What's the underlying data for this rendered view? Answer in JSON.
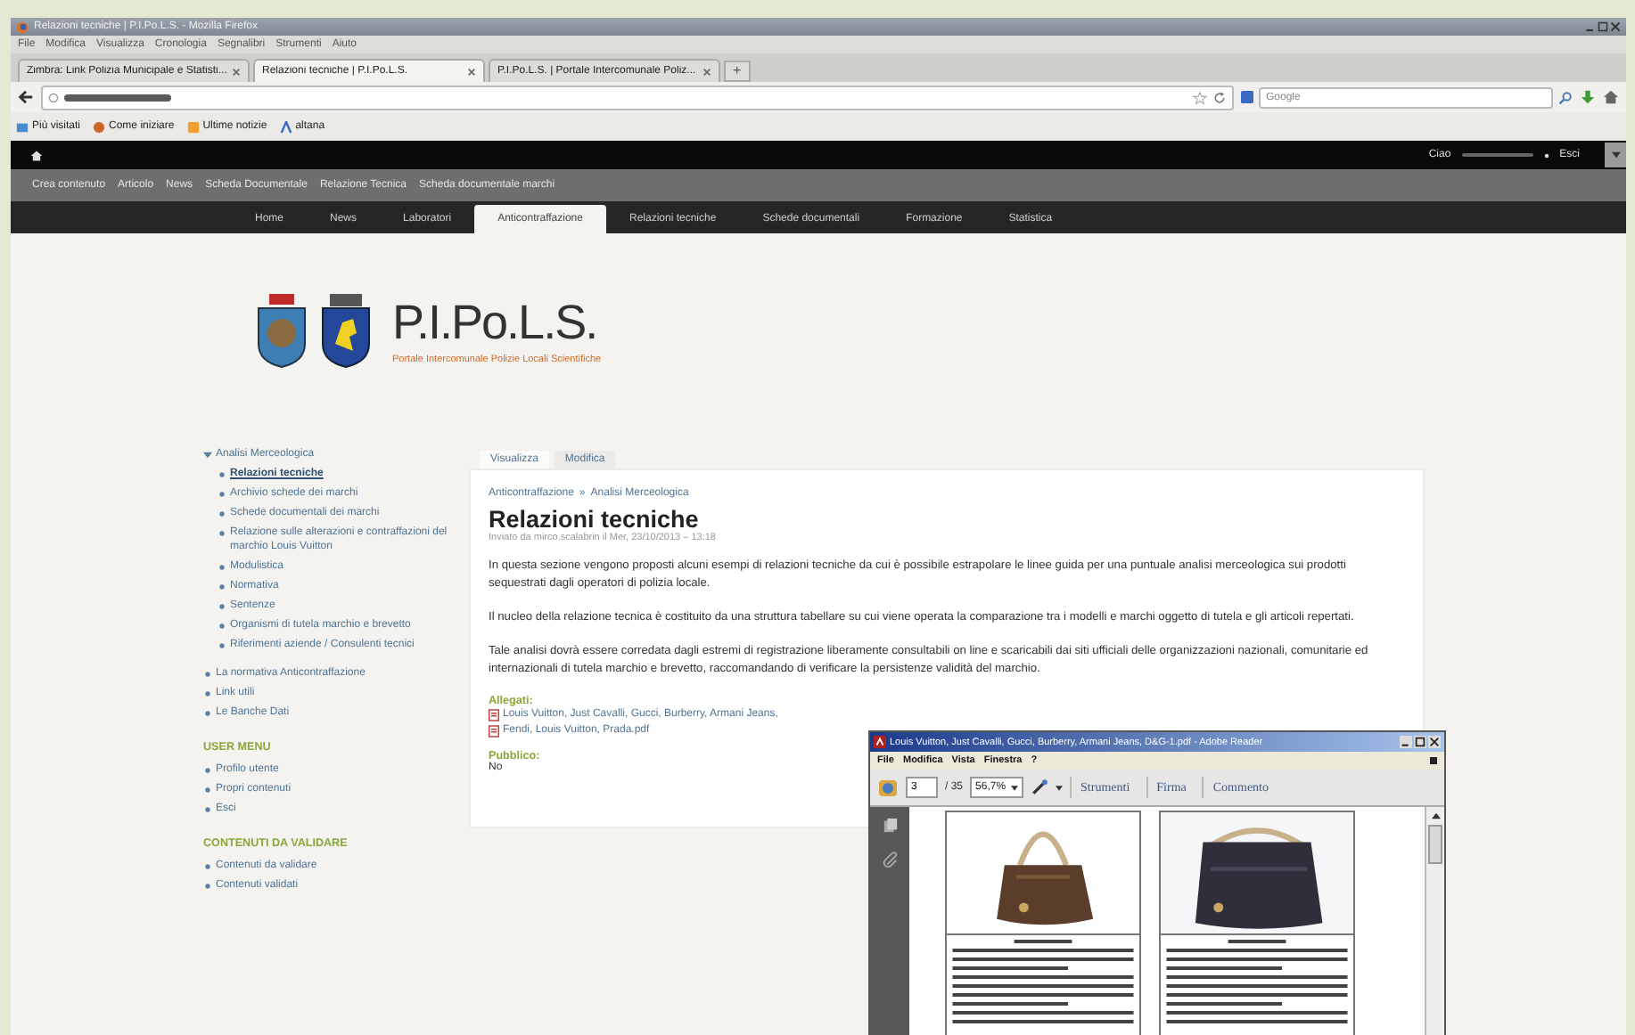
{
  "browser": {
    "title": "Relazioni tecniche | P.I.Po.L.S. - Mozilla Firefox",
    "menu": [
      "File",
      "Modifica",
      "Visualizza",
      "Cronologia",
      "Segnalibri",
      "Strumenti",
      "Aiuto"
    ],
    "tabs": [
      {
        "label": "Zimbra: Link Polizia Municipale e Statisti...",
        "selected": false
      },
      {
        "label": "Relazioni tecniche | P.I.Po.L.S.",
        "selected": true
      },
      {
        "label": "P.I.Po.L.S. | Portale Intercomunale Poliz...",
        "selected": false
      }
    ],
    "new_tab": "+",
    "search": {
      "placeholder": "Google"
    },
    "bookmarks": [
      "Più visitati",
      "Come iniziare",
      "Ultime notizie",
      "altana"
    ]
  },
  "toolbar": {
    "greeting": "Ciao",
    "logout": "Esci"
  },
  "shortcuts": [
    "Crea contenuto",
    "Articolo",
    "News",
    "Scheda Documentale",
    "Relazione Tecnica",
    "Scheda documentale marchi"
  ],
  "nav": [
    {
      "label": "Home",
      "selected": false
    },
    {
      "label": "News",
      "selected": false
    },
    {
      "label": "Laboratori",
      "selected": false
    },
    {
      "label": "Anticontraffazione",
      "selected": true
    },
    {
      "label": "Relazioni tecniche",
      "selected": false
    },
    {
      "label": "Schede documentali",
      "selected": false
    },
    {
      "label": "Formazione",
      "selected": false
    },
    {
      "label": "Statistica",
      "selected": false
    }
  ],
  "site": {
    "name": "P.I.Po.L.S.",
    "slogan": "Portale Intercomunale Polizie Locali Scientifiche"
  },
  "sidebar": {
    "tree": [
      {
        "label": "Analisi Merceologica",
        "selected": false,
        "expanded": true,
        "children": [
          {
            "label": "Relazioni tecniche",
            "selected": true
          },
          {
            "label": "Archivio schede dei marchi",
            "selected": false
          },
          {
            "label": "Schede documentali dei marchi",
            "selected": false
          },
          {
            "label": "Relazione sulle alterazioni e contraffazioni del marchio Louis Vuitton",
            "selected": false
          },
          {
            "label": "Modulistica",
            "selected": false
          },
          {
            "label": "Normativa",
            "selected": false
          },
          {
            "label": "Sentenze",
            "selected": false
          },
          {
            "label": "Organismi di tutela marchio e brevetto",
            "selected": false
          },
          {
            "label": "Riferimenti aziende / Consulenti tecnici",
            "selected": false
          }
        ]
      },
      {
        "label": "La normativa Anticontraffazione",
        "selected": false
      },
      {
        "label": "Link utili",
        "selected": false
      },
      {
        "label": "Le Banche Dati",
        "selected": false
      }
    ],
    "menus": [
      {
        "heading": "USER MENU",
        "items": [
          "Profilo utente",
          "Propri contenuti",
          "Esci"
        ]
      },
      {
        "heading": "CONTENUTI DA VALIDARE",
        "items": [
          "Contenuti da validare",
          "Contenuti validati"
        ]
      }
    ]
  },
  "main": {
    "tabs": [
      {
        "label": "Visualizza",
        "selected": true
      },
      {
        "label": "Modifica",
        "selected": false
      }
    ],
    "breadcrumb": [
      "Anticontraffazione",
      "Analisi Merceologica"
    ],
    "separator": "»",
    "title": "Relazioni tecniche",
    "submitted": "Inviato da mirco.scalabrin il Mer, 23/10/2013 – 13:18",
    "paragraphs": [
      "In questa sezione vengono proposti alcuni esempi di relazioni tecniche da cui è possibile estrapolare le linee guida per una puntuale analisi merceologica sui prodotti sequestrati dagli operatori di polizia locale.",
      "Il nucleo della relazione tecnica è costituito da una struttura tabellare su cui viene operata la comparazione tra i modelli e marchi oggetto di tutela e gli articoli repertati.",
      "Tale analisi dovrà essere corredata dagli estremi di registrazione liberamente consultabili on line e scaricabili dai siti ufficiali delle organizzazioni nazionali, comunitarie ed internazionali di tutela marchio e brevetto, raccomandando di verificare la persistenze validità del marchio."
    ],
    "attachments_label": "Allegati:",
    "attachments": [
      "Louis Vuitton, Just Cavalli, Gucci, Burberry, Armani Jeans,",
      "Fendi, Louis Vuitton, Prada.pdf"
    ],
    "public_label": "Pubblico:",
    "public_value": "No"
  },
  "pdf_viewer": {
    "title": "Louis Vuitton, Just Cavalli, Gucci, Burberry, Armani Jeans, D&G-1.pdf - Adobe Reader",
    "menu": [
      "File",
      "Modifica",
      "Vista",
      "Finestra",
      "?"
    ],
    "page": "3",
    "page_count": "/ 35",
    "zoom": "56,7%",
    "buttons": [
      "Strumenti",
      "Firma",
      "Commento"
    ]
  }
}
